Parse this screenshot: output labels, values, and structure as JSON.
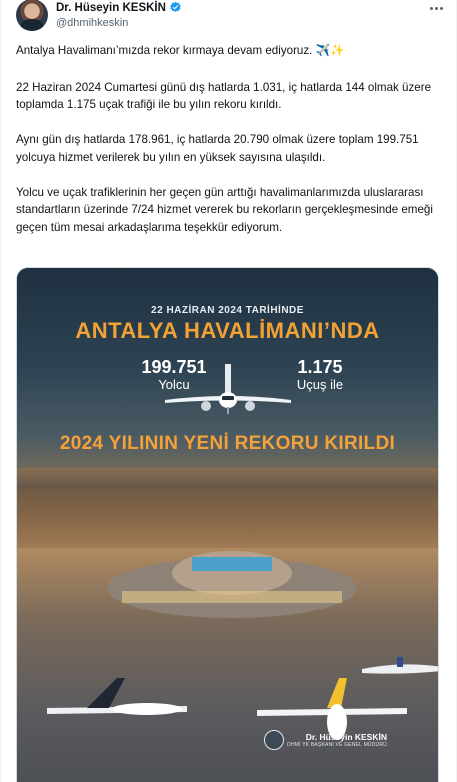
{
  "author": {
    "name": "Dr. Hüseyin KESKİN",
    "handle": "@dhmihkeskin",
    "verified": true
  },
  "icons": {
    "verified": "verified-badge-icon",
    "more": "more-options-icon",
    "emoji": "✈️✨"
  },
  "tweet": {
    "p1": "Antalya Havalimanı’mızda rekor kırmaya devam ediyoruz. ✈️✨",
    "p2": "22 Haziran 2024 Cumartesi günü dış hatlarda 1.031, iç hatlarda 144 olmak üzere toplamda 1.175 uçak trafiği ile bu yılın rekoru kırıldı.",
    "p3": "Aynı gün dış hatlarda 178.961, iç hatlarda 20.790 olmak üzere toplam 199.751 yolcuya hizmet verilerek bu yılın en yüksek sayısına ulaşıldı.",
    "p4": "Yolcu ve uçak trafiklerinin her geçen gün arttığı havalimanlarımızda uluslararası standartların üzerinde 7/24 hizmet vererek bu rekorların gerçekleşmesinde emeği geçen tüm mesai arkadaşlarıma teşekkür ediyorum."
  },
  "image": {
    "subtitle": "22 HAZİRAN 2024 TARİHİNDE",
    "title": "ANTALYA HAVALİMANI’NDA",
    "passengers_value": "199.751",
    "passengers_label": "Yolcu",
    "flights_value": "1.175",
    "flights_label": "Uçuş ile",
    "record": "2024 YILININ YENİ REKORU KIRILDI",
    "footer_name": "Dr. Hüseyin KESKİN",
    "footer_role": "DHMİ YK BAŞKANI VE GENEL MÜDÜRÜ"
  },
  "colors": {
    "brand_orange": "#f2a233",
    "text": "#0f1419",
    "muted": "#536471",
    "verified_blue": "#1d9bf0"
  }
}
